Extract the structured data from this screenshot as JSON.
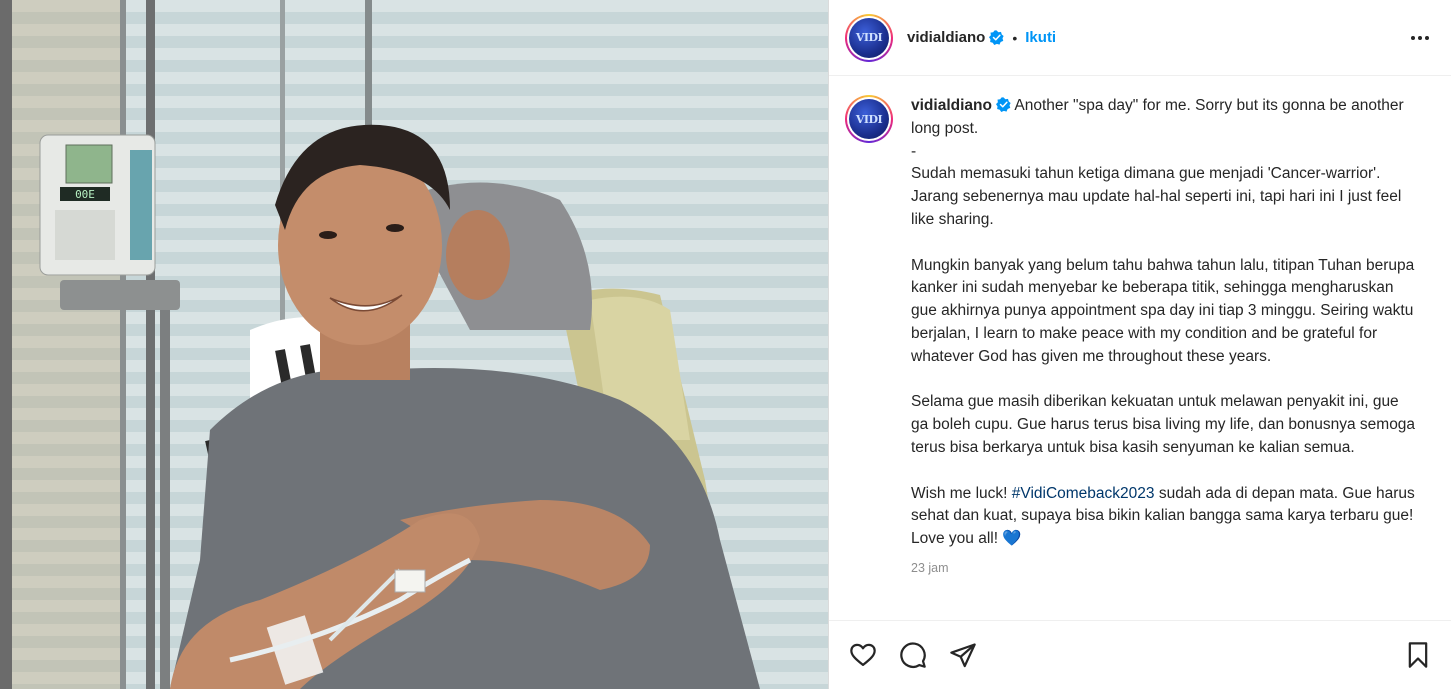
{
  "post": {
    "username": "vidialdiano",
    "follow_label": "Ikuti",
    "separator": "•",
    "avatar_text": "VIDI",
    "caption_intro": "Another \"spa day\" for me. Sorry but its gonna be another long post.",
    "caption_dash": "-",
    "caption_p1": "Sudah memasuki tahun ketiga dimana gue menjadi 'Cancer-warrior'. Jarang sebenernya mau update hal-hal seperti ini, tapi hari ini I just feel like sharing.",
    "caption_p2": "Mungkin banyak yang belum tahu bahwa tahun lalu, titipan Tuhan berupa kanker ini sudah menyebar ke beberapa titik, sehingga mengharuskan gue akhirnya punya appointment spa day ini tiap 3 minggu. Seiring waktu berjalan, I learn to make peace with my condition and be grateful for whatever God has given me throughout these years.",
    "caption_p3": "Selama gue masih diberikan kekuatan untuk melawan penyakit ini, gue ga boleh cupu. Gue harus terus bisa living my life, dan bonusnya semoga terus bisa berkarya untuk bisa kasih senyuman ke kalian semua.",
    "caption_p4_pre": "Wish me luck! ",
    "caption_hashtag": "#VidiComeback2023",
    "caption_p4_post": " sudah ada di depan mata. Gue harus sehat dan kuat, supaya bisa bikin kalian bangga sama karya terbaru gue! Love you all! ",
    "heart": "💙",
    "time": "23 jam",
    "pump_display": "00E"
  },
  "icons": {
    "like": "heart-icon",
    "comment": "comment-icon",
    "share": "share-icon",
    "save": "bookmark-icon",
    "more": "more-options-icon",
    "verified": "verified-badge-icon"
  },
  "colors": {
    "follow": "#0095f6",
    "verified": "#0095f6",
    "hashtag": "#00376b",
    "meta": "#8e8e8e"
  }
}
